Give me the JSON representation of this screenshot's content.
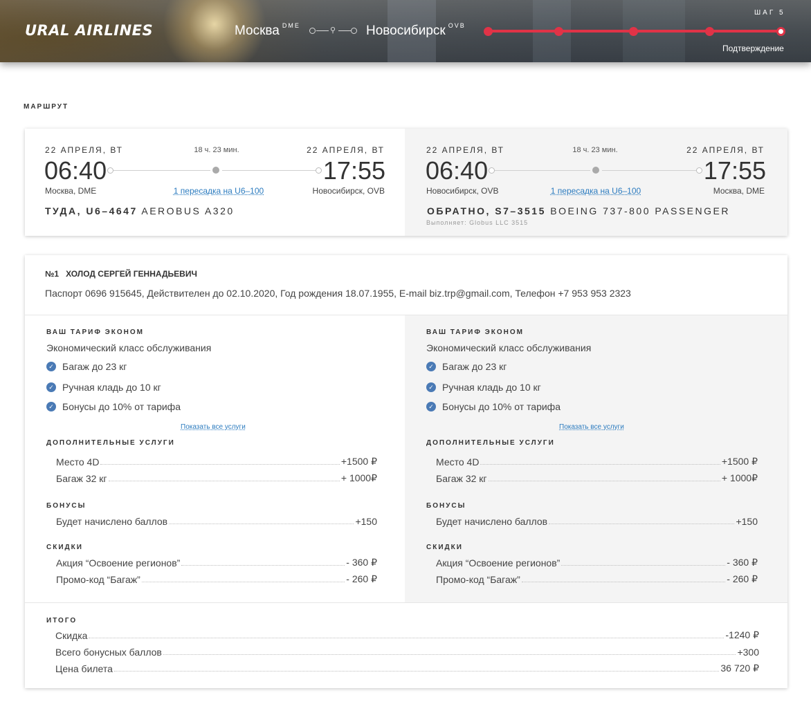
{
  "header": {
    "logo": "URAL AIRLINES",
    "from_city": "Москва",
    "from_code": "DME",
    "to_city": "Новосибирск",
    "to_code": "OVB",
    "step_label": "ШАГ 5",
    "step_name": "Подтверждение",
    "progress": {
      "total_steps": 5,
      "current_step": 5
    },
    "accent_color": "#e03347"
  },
  "route_section_title": "МАРШРУТ",
  "segments": [
    {
      "dep_date": "22 АПРЕЛЯ, ВТ",
      "arr_date": "22 АПРЕЛЯ, ВТ",
      "duration": "18 ч. 23 мин.",
      "dep_time": "06:40",
      "arr_time": "17:55",
      "dep_city": "Москва, DME",
      "arr_city": "Новосибирск, OVB",
      "transfer": "1 пересадка на U6–100",
      "direction": "ТУДА, U6–4647",
      "aircraft": "AEROBUS A320",
      "operated_by": ""
    },
    {
      "dep_date": "22 АПРЕЛЯ, ВТ",
      "arr_date": "22 АПРЕЛЯ, ВТ",
      "duration": "18 ч. 23 мин.",
      "dep_time": "06:40",
      "arr_time": "17:55",
      "dep_city": "Новосибирск, OVB",
      "arr_city": "Москва, DME",
      "transfer": "1 пересадка на U6–100",
      "direction": "ОБРАТНО, S7–3515",
      "aircraft": "BOEING 737-800 PASSENGER",
      "operated_by": "Выполняет: Globus LLC 3515"
    }
  ],
  "passenger": {
    "number": "№1",
    "name": "ХОЛОД СЕРГЕЙ ГЕННАДЬЕВИЧ",
    "details": "Паспорт 0696 915645, Действителен до 02.10.2020, Год рождения 18.07.1955, E-mail biz.trp@gmail.com, Телефон +7 953 953 2323"
  },
  "fares": [
    {
      "tariff_label": "ВАШ ТАРИФ ЭКОНОМ",
      "service_class": "Экономический класс обслуживания",
      "features": [
        "Багаж до 23 кг",
        "Ручная кладь до 10 кг",
        "Бонусы до 10% от тарифа"
      ],
      "show_all": "Показать все услуги",
      "extras_label": "ДОПОЛНИТЕЛЬНЫЕ УСЛУГИ",
      "extras": [
        {
          "name": "Место 4D",
          "value": "+1500 ₽"
        },
        {
          "name": "Багаж 32 кг",
          "value": "+ 1000₽"
        }
      ],
      "bonus_label": "БОНУСЫ",
      "bonus": {
        "name": "Будет начислено баллов",
        "value": "+150"
      },
      "discount_label": "СКИДКИ",
      "discounts": [
        {
          "name": "Акция “Освоение регионов”",
          "value": "- 360 ₽"
        },
        {
          "name": "Промо-код “Багаж”",
          "value": "- 260 ₽"
        }
      ]
    },
    {
      "tariff_label": "ВАШ ТАРИФ ЭКОНОМ",
      "service_class": "Экономический класс обслуживания",
      "features": [
        "Багаж до 23 кг",
        "Ручная кладь до 10 кг",
        "Бонусы до 10% от тарифа"
      ],
      "show_all": "Показать все услуги",
      "extras_label": "ДОПОЛНИТЕЛЬНЫЕ УСЛУГИ",
      "extras": [
        {
          "name": "Место 4D",
          "value": "+1500 ₽"
        },
        {
          "name": "Багаж 32 кг",
          "value": "+ 1000₽"
        }
      ],
      "bonus_label": "БОНУСЫ",
      "bonus": {
        "name": "Будет начислено баллов",
        "value": "+150"
      },
      "discount_label": "СКИДКИ",
      "discounts": [
        {
          "name": "Акция “Освоение регионов”",
          "value": "- 360 ₽"
        },
        {
          "name": "Промо-код “Багаж”",
          "value": "- 260 ₽"
        }
      ]
    }
  ],
  "totals": {
    "label": "ИТОГО",
    "rows": [
      {
        "name": "Скидка",
        "value": "-1240 ₽"
      },
      {
        "name": "Всего бонусных баллов",
        "value": "+300"
      },
      {
        "name": "Цена билета",
        "value": "36 720 ₽"
      }
    ]
  }
}
